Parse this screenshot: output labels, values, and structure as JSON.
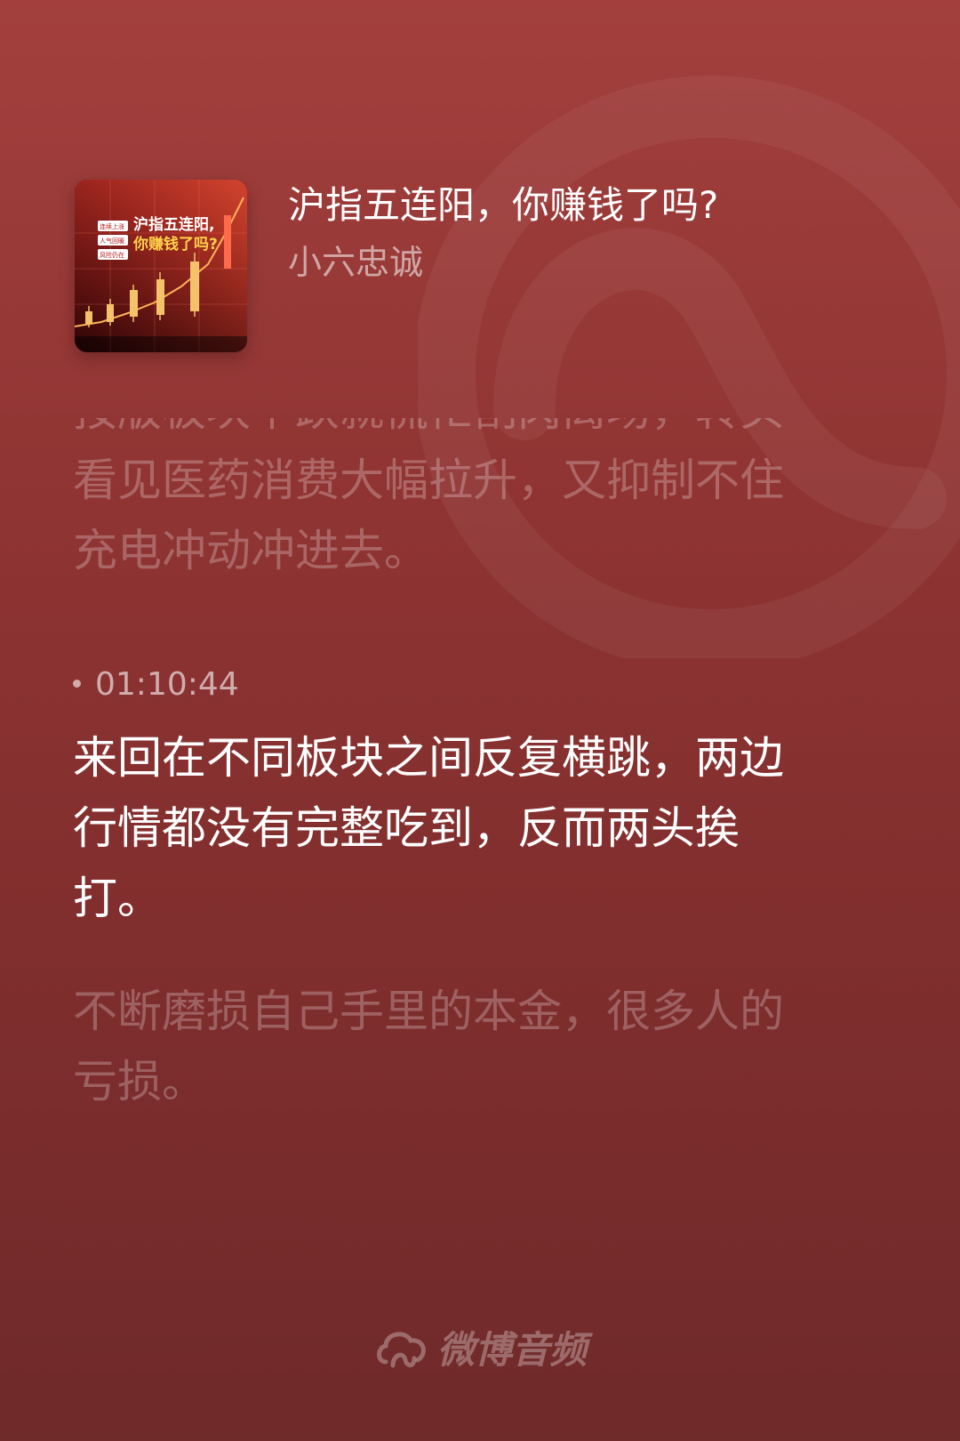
{
  "track": {
    "title": "沪指五连阳，你赚钱了吗?",
    "author": "小六忠诚"
  },
  "cover": {
    "headline_line1": "沪指五连阳,",
    "headline_line2": "你赚钱了吗?",
    "tags": [
      "连续上涨",
      "人气回暖",
      "风险仍在"
    ],
    "accent_color": "#e0322e",
    "candle_color": "#f3c26b"
  },
  "lyrics": {
    "previous_partial": "按版板块下跌就慌忙割肉离场，转头",
    "previous_lines": [
      "看见医药消费大幅拉升，又抑制不住",
      "充电冲动冲进去。"
    ],
    "current_time": "01:10:44",
    "current_lines": [
      "来回在不同板块之间反复横跳，两边",
      "行情都没有完整吃到，反而两头挨",
      "打。"
    ],
    "next_lines": [
      "不断磨损自己手里的本金，很多人的",
      "亏损。"
    ]
  },
  "brand": {
    "name": "微博音频",
    "icon": "weibo-audio-logo-icon"
  },
  "colors": {
    "background_top": "#a3403d",
    "background_bottom": "#6f2a2a",
    "text_active": "#ffffff"
  }
}
